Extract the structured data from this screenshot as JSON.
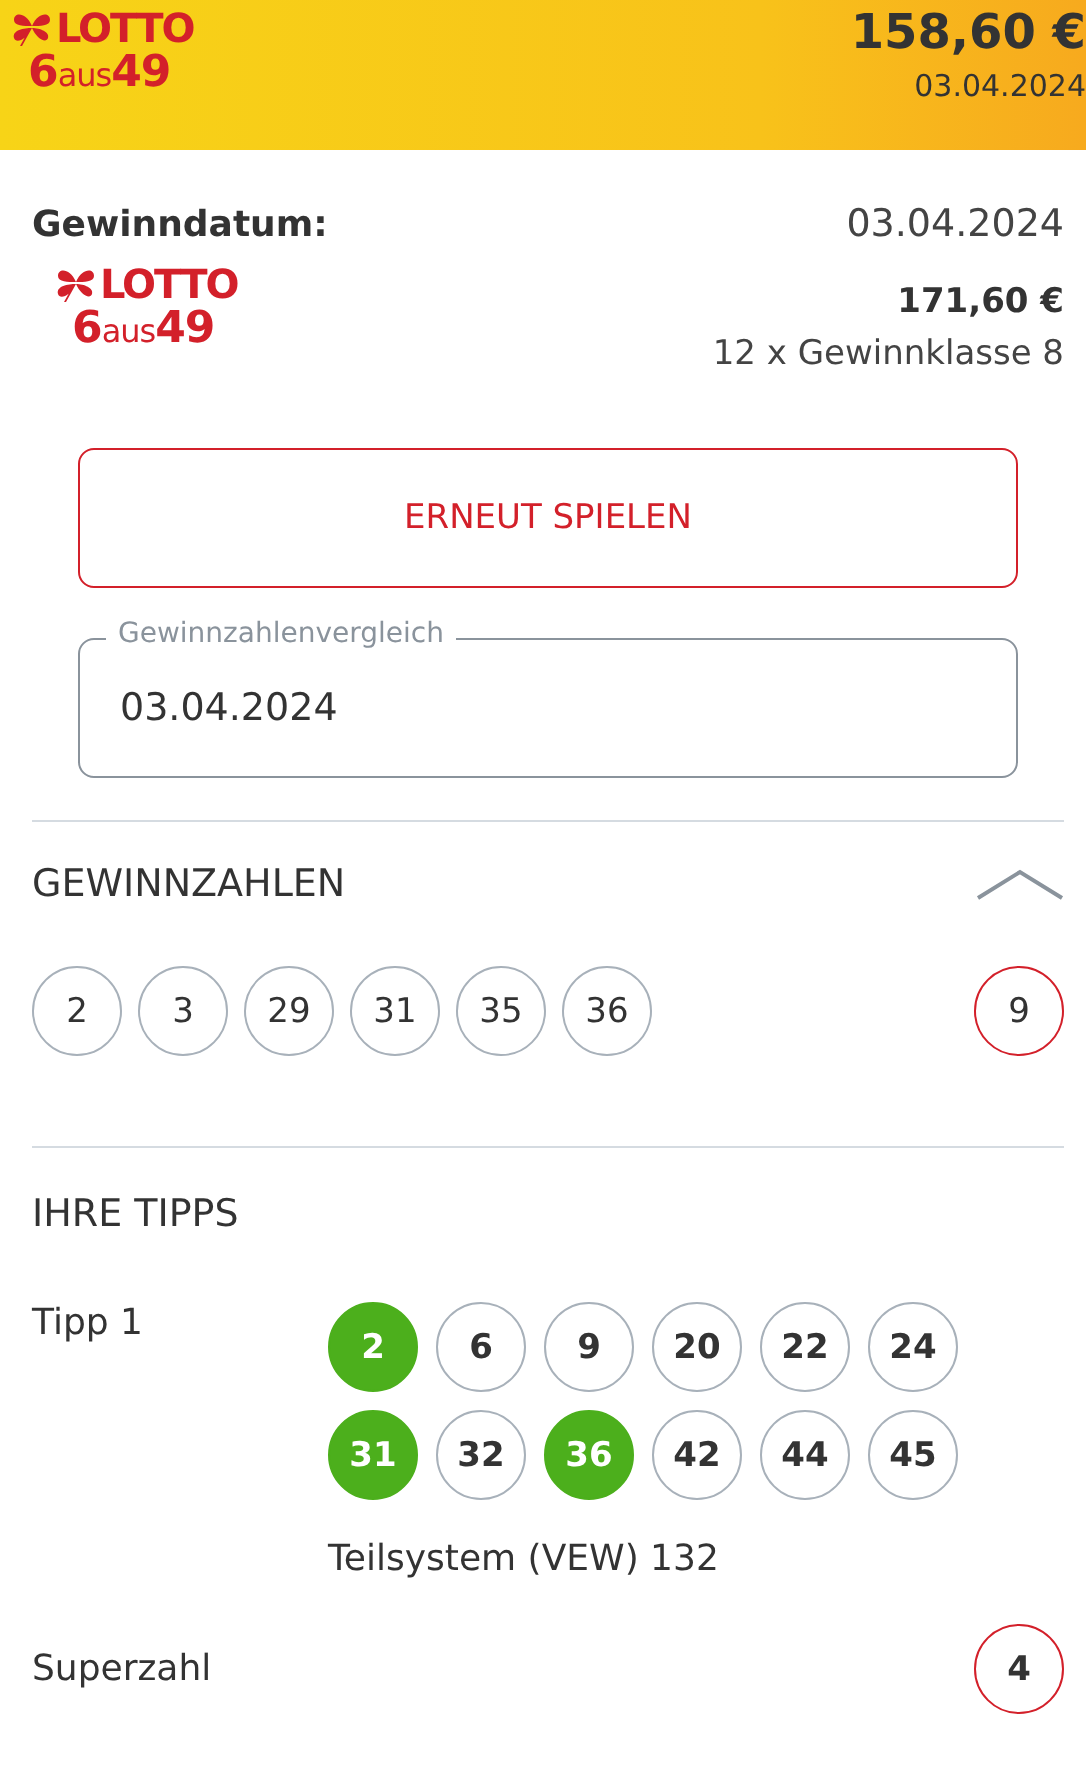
{
  "header": {
    "logo": {
      "brand": "LOTTO",
      "six": "6",
      "aus": "aus",
      "fortynine": "49"
    },
    "amount": "158,60 €",
    "date": "03.04.2024"
  },
  "win": {
    "label": "Gewinndatum:",
    "date": "03.04.2024",
    "logo": {
      "brand": "LOTTO",
      "six": "6",
      "aus": "aus",
      "fortynine": "49"
    },
    "amount": "171,60 €",
    "detail": "12 x Gewinnklasse 8"
  },
  "replay_button": "ERNEUT SPIELEN",
  "compare_field": {
    "label": "Gewinnzahlenvergleich",
    "value": "03.04.2024"
  },
  "winning_numbers": {
    "title": "GEWINNZAHLEN",
    "expanded": true,
    "numbers": [
      "2",
      "3",
      "29",
      "31",
      "35",
      "36"
    ],
    "superzahl": "9"
  },
  "tips": {
    "title": "IHRE TIPPS",
    "items": [
      {
        "label": "Tipp 1",
        "numbers": [
          {
            "n": "2",
            "hit": true
          },
          {
            "n": "6",
            "hit": false
          },
          {
            "n": "9",
            "hit": false
          },
          {
            "n": "20",
            "hit": false
          },
          {
            "n": "22",
            "hit": false
          },
          {
            "n": "24",
            "hit": false
          },
          {
            "n": "31",
            "hit": true
          },
          {
            "n": "32",
            "hit": false
          },
          {
            "n": "36",
            "hit": true
          },
          {
            "n": "42",
            "hit": false
          },
          {
            "n": "44",
            "hit": false
          },
          {
            "n": "45",
            "hit": false
          }
        ],
        "system": "Teilsystem (VEW) 132"
      }
    ],
    "superzahl_label": "Superzahl",
    "superzahl": "4"
  }
}
